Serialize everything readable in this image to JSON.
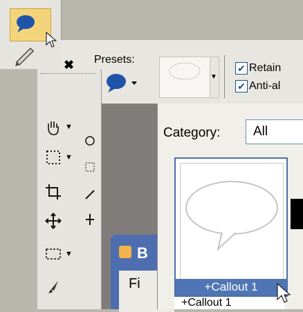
{
  "colors": {
    "accent": "#f3d47a",
    "selection": "#4f75b4",
    "workspace": "#7f7c7a"
  },
  "toolbar_mini": {
    "items": [
      {
        "icon": "callout-icon",
        "active": true
      },
      {
        "icon": "pen-icon",
        "active": false
      }
    ]
  },
  "tool_options": {
    "close_icon": "✖",
    "pin_icon": "📌",
    "presets_label": "Presets:",
    "retain_label": "Retain",
    "antialias_label": "Anti-al",
    "retain_checked": "✔",
    "antialias_checked": "✔"
  },
  "vertical_tools": [
    {
      "icon": "pan-hand-icon",
      "has_menu": true
    },
    {
      "icon": "marquee-icon",
      "has_menu": true
    },
    {
      "icon": "crop-icon",
      "has_menu": false
    },
    {
      "icon": "move-icon",
      "has_menu": false
    },
    {
      "icon": "rect-select-icon",
      "has_menu": true
    },
    {
      "icon": "brush-icon",
      "has_menu": false
    }
  ],
  "presets_panel": {
    "category_label": "Category:",
    "category_value": "All",
    "thumb_label": "+Callout 1",
    "thumb2_label": "+Callout 1"
  },
  "background_window": {
    "title": "B",
    "inner_text": "Fi"
  }
}
